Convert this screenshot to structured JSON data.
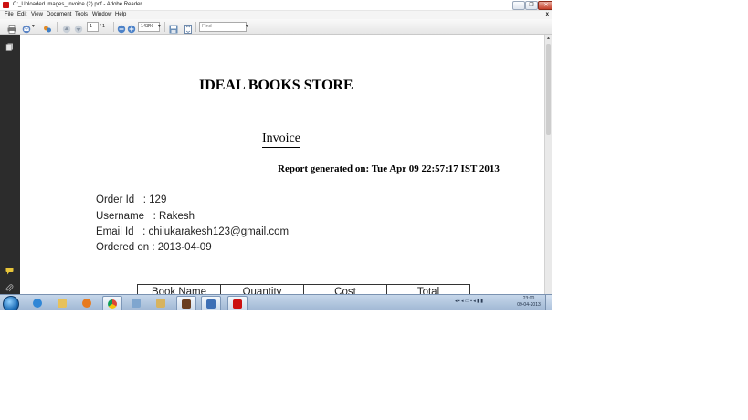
{
  "window": {
    "title": "C:_Uploaded Images_Invoice (2).pdf - Adobe Reader",
    "minimize_label": "–",
    "restore_label": "❐",
    "close_label": "✕"
  },
  "menu": {
    "items": [
      "File",
      "Edit",
      "View",
      "Document",
      "Tools",
      "Window",
      "Help"
    ],
    "close_label": "x"
  },
  "toolbar": {
    "page_current": "1",
    "page_total": "/ 1",
    "zoom": "143%",
    "find_placeholder": "Find"
  },
  "document": {
    "store_name": "IDEAL BOOKS STORE",
    "heading": "Invoice",
    "report_line": "Report generated on: Tue Apr 09 22:57:17 IST 2013",
    "fields": [
      "Order Id   : 129",
      "Username   : Rakesh",
      "Email Id   : chilukarakesh123@gmail.com",
      "Ordered on : 2013-04-09"
    ],
    "table_headers": [
      "Book Name",
      "Quantity",
      "Cost",
      "Total"
    ]
  },
  "taskbar": {
    "clock_time": "23:00",
    "clock_date": "09-04-2013",
    "tray_icons": "◂ ▪ ◂ ▭ ▪ ◂ ▮ ▮"
  },
  "icons": {
    "app": "adobe-reader-icon",
    "print": "print-icon",
    "email": "email-icon",
    "collaborate": "collaborate-icon",
    "prev_page": "arrow-up-icon",
    "next_page": "arrow-down-icon",
    "zoom_out": "zoom-out-icon",
    "zoom_in": "zoom-in-icon",
    "save": "save-icon",
    "fit": "fit-page-icon",
    "pages_panel": "pages-icon",
    "comment": "comment-icon",
    "attachment": "paperclip-icon"
  },
  "colors": {
    "adobe_red": "#cc1111",
    "nav_pane": "#2c2c2c",
    "taskbar": "#9eb6d3"
  }
}
